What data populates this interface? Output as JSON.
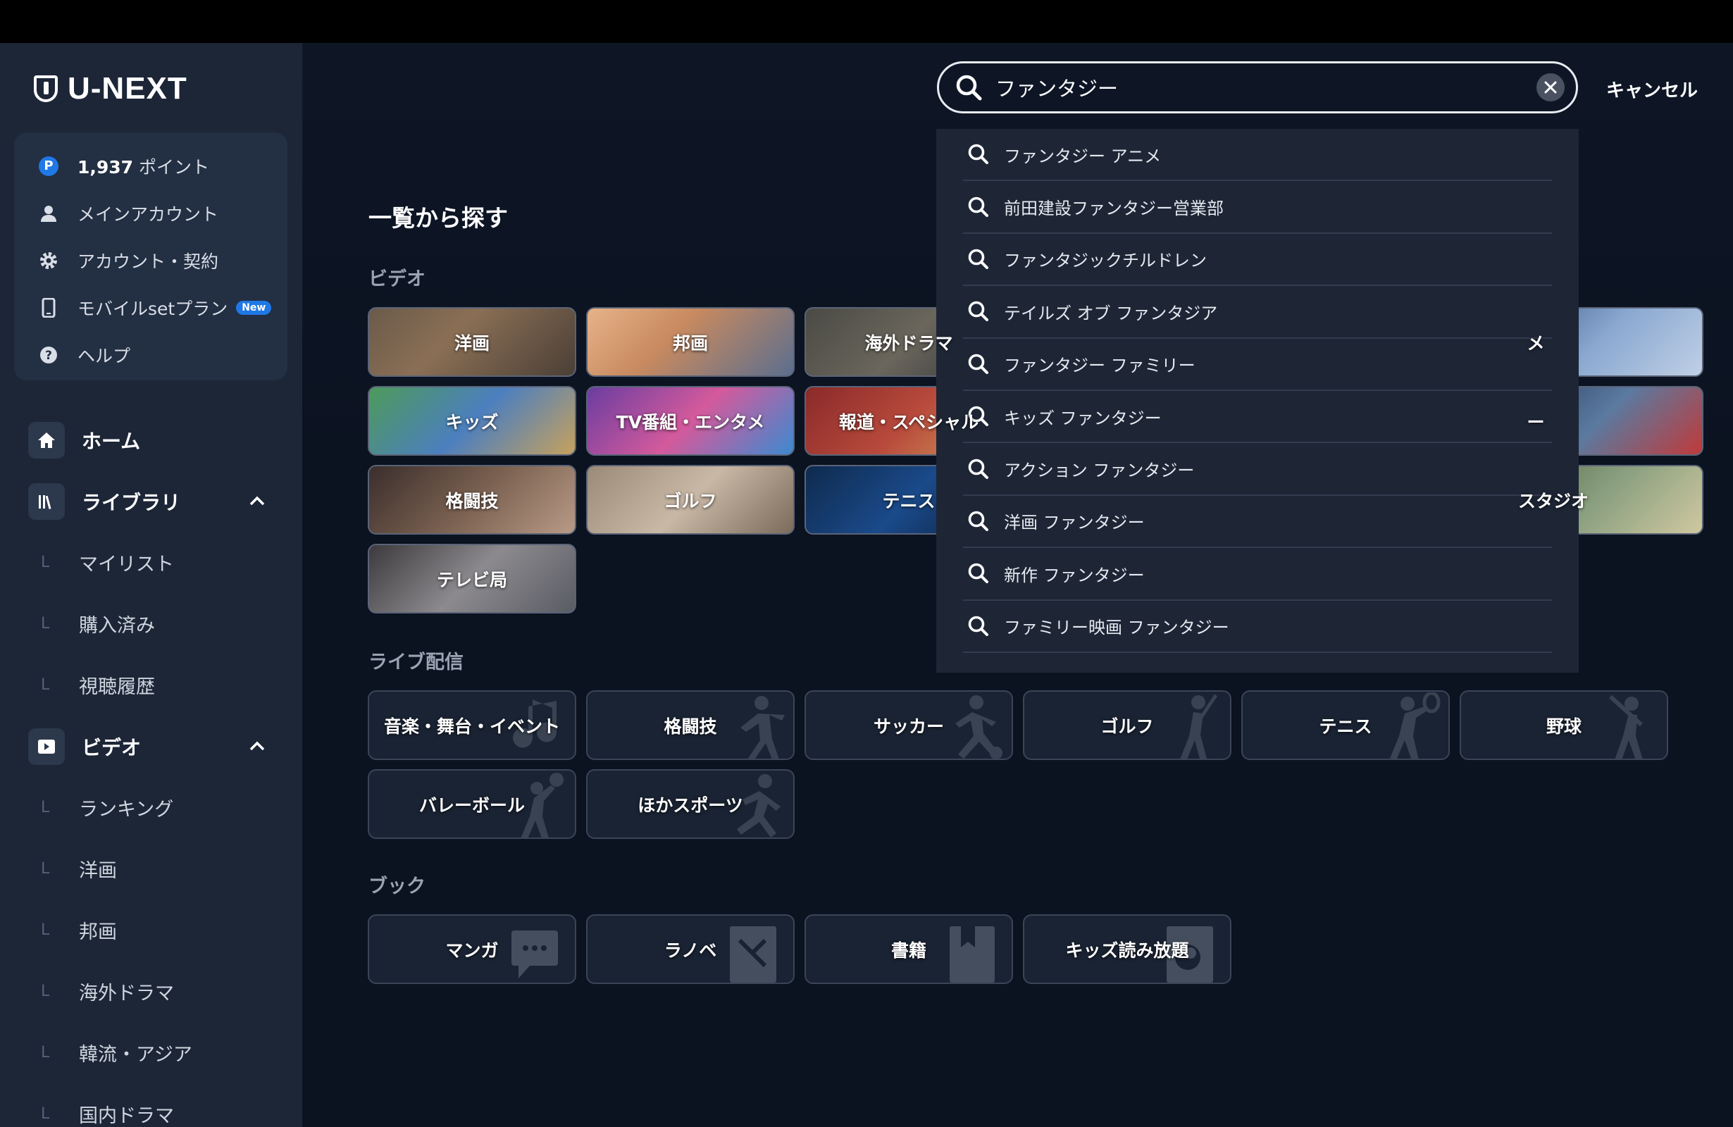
{
  "app": {
    "logo_text": "U-NEXT"
  },
  "account": {
    "points": "1,937",
    "points_suffix": " ポイント",
    "main_account": "メインアカウント",
    "account_contract": "アカウント・契約",
    "mobile_plan": "モバイルsetプラン",
    "new_badge": "New",
    "help": "ヘルプ"
  },
  "nav": {
    "home": "ホーム",
    "library": "ライブラリ",
    "library_items": [
      "マイリスト",
      "購入済み",
      "視聴履歴"
    ],
    "video": "ビデオ",
    "video_items": [
      "ランキング",
      "洋画",
      "邦画",
      "海外ドラマ",
      "韓流・アジア",
      "国内ドラマ"
    ]
  },
  "main": {
    "title": "一覧から探す",
    "video_heading": "ビデオ",
    "video_tiles": [
      "洋画",
      "邦画",
      "海外ドラマ",
      "キッズ",
      "TV番組・エンタメ",
      "報道・スペシャル",
      "格闘技",
      "ゴルフ",
      "テニス",
      "テレビ局"
    ],
    "video_tiles_right": [
      "メ",
      "ー",
      "スタジオ"
    ],
    "live_heading": "ライブ配信",
    "live_tiles": [
      "音楽・舞台・イベント",
      "格闘技",
      "サッカー",
      "ゴルフ",
      "テニス",
      "野球",
      "バレーボール",
      "ほかスポーツ"
    ],
    "book_heading": "ブック",
    "book_tiles": [
      "マンガ",
      "ラノベ",
      "書籍",
      "キッズ読み放題"
    ]
  },
  "search": {
    "value": "ファンタジー",
    "cancel": "キャンセル",
    "suggestions": [
      "ファンタジー アニメ",
      "前田建設ファンタジー営業部",
      "ファンタジックチルドレン",
      "テイルズ オブ ファンタジア",
      "ファンタジー ファミリー",
      "キッズ ファンタジー",
      "アクション ファンタジー",
      "洋画 ファンタジー",
      "新作 ファンタジー",
      "ファミリー映画 ファンタジー"
    ]
  },
  "colors": {
    "accent": "#1f78e6",
    "sidebar": "#1c2637",
    "background": "#0b1220"
  }
}
